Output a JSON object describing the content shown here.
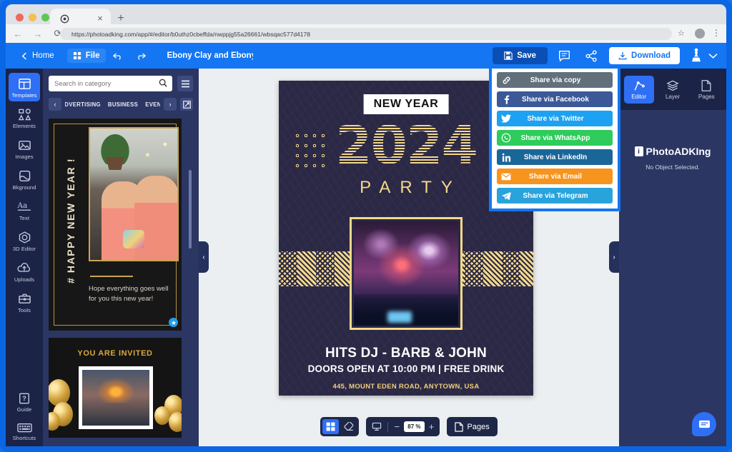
{
  "browser": {
    "url": "https://photoadking.com/app/#/editor/b0uthz0cbeffda/nwppjg55a26661/wbsqac577d4178",
    "tab_close": "×",
    "new_tab": "+",
    "back": "←",
    "forward": "→",
    "reload": "⟳",
    "star": "☆",
    "menu": "⋮"
  },
  "header": {
    "home": "Home",
    "file": "File",
    "undo": "undo",
    "redo": "redo",
    "title": "Ebony Clay and Ebony Clay",
    "save": "Save",
    "download": "Download",
    "comment_icon": "comment-icon",
    "share_icon": "share-icon",
    "crown_icon": "crown-icon",
    "chevron": "⌄"
  },
  "left_rail": {
    "items": [
      {
        "label": "Templates",
        "icon": "templates-icon",
        "active": true
      },
      {
        "label": "Elements",
        "icon": "elements-icon",
        "active": false
      },
      {
        "label": "Images",
        "icon": "images-icon",
        "active": false
      },
      {
        "label": "Bkground",
        "icon": "background-icon",
        "active": false
      },
      {
        "label": "Text",
        "icon": "text-icon",
        "active": false
      },
      {
        "label": "3D Editor",
        "icon": "3d-editor-icon",
        "active": false
      },
      {
        "label": "Uploads",
        "icon": "uploads-icon",
        "active": false
      },
      {
        "label": "Tools",
        "icon": "tools-icon",
        "active": false
      }
    ],
    "bottom": [
      {
        "label": "Guide",
        "icon": "guide-icon"
      },
      {
        "label": "Shortcuts",
        "icon": "shortcuts-icon"
      }
    ]
  },
  "templates_panel": {
    "search_placeholder": "Search in category",
    "search_value": "",
    "list_icon": "list-view-icon",
    "prev": "‹",
    "next": "›",
    "expand_icon": "expand-icon",
    "categories": [
      "ADVERTISING",
      "BUSINESS",
      "EVENT"
    ],
    "cards": [
      {
        "name": "happy-new-year-template",
        "vertical_text": "# HAPPY NEW YEAR !",
        "message": "Hope everything goes well for you this new year!"
      },
      {
        "name": "you-are-invited-template",
        "title": "YOU ARE INVITED"
      }
    ]
  },
  "canvas": {
    "poster": {
      "badge": "NEW YEAR",
      "year": "2024",
      "party": "PARTY",
      "headline": "HITS DJ  - BARB & JOHN",
      "subline": "DOORS OPEN AT 10:00 PM | FREE DRINK",
      "address": "445, MOUNT EDEN ROAD, ANYTOWN, USA"
    },
    "nav_prev": "‹",
    "nav_next": "›",
    "toolbar": {
      "grid_icon": "grid-icon",
      "eraser_icon": "eraser-icon",
      "present_icon": "present-icon",
      "zoom_out": "−",
      "zoom_value": "87 %",
      "zoom_in": "+",
      "pages_label": "Pages",
      "pages_icon": "page-icon"
    }
  },
  "right_panel": {
    "tabs": [
      {
        "label": "Editor",
        "icon": "editor-icon",
        "active": true
      },
      {
        "label": "Layer",
        "icon": "layers-icon",
        "active": false
      },
      {
        "label": "Pages",
        "icon": "pages-icon",
        "active": false
      }
    ],
    "brand": "PhotoADKIng",
    "status": "No Object Selected."
  },
  "share_menu": {
    "items": [
      {
        "label": "Share via copy",
        "icon": "link-icon",
        "color": "#62707b"
      },
      {
        "label": "Share via Facebook",
        "icon": "facebook-icon",
        "color": "#3b5998"
      },
      {
        "label": "Share via Twitter",
        "icon": "twitter-icon",
        "color": "#1da1f2"
      },
      {
        "label": "Share via WhatsApp",
        "icon": "whatsapp-icon",
        "color": "#2ecc5b"
      },
      {
        "label": "Share via LinkedIn",
        "icon": "linkedin-icon",
        "color": "#1b6699"
      },
      {
        "label": "Share via Email",
        "icon": "email-icon",
        "color": "#f7941e"
      },
      {
        "label": "Share via Telegram",
        "icon": "telegram-icon",
        "color": "#29a3dc"
      }
    ]
  },
  "chat": {
    "icon": "chat-icon"
  },
  "colors": {
    "brand_blue": "#1476f2",
    "rail_dark": "#1b2347",
    "panel": "#2b3663",
    "poster_bg": "#2b2845",
    "gold": "#f3d98a"
  }
}
